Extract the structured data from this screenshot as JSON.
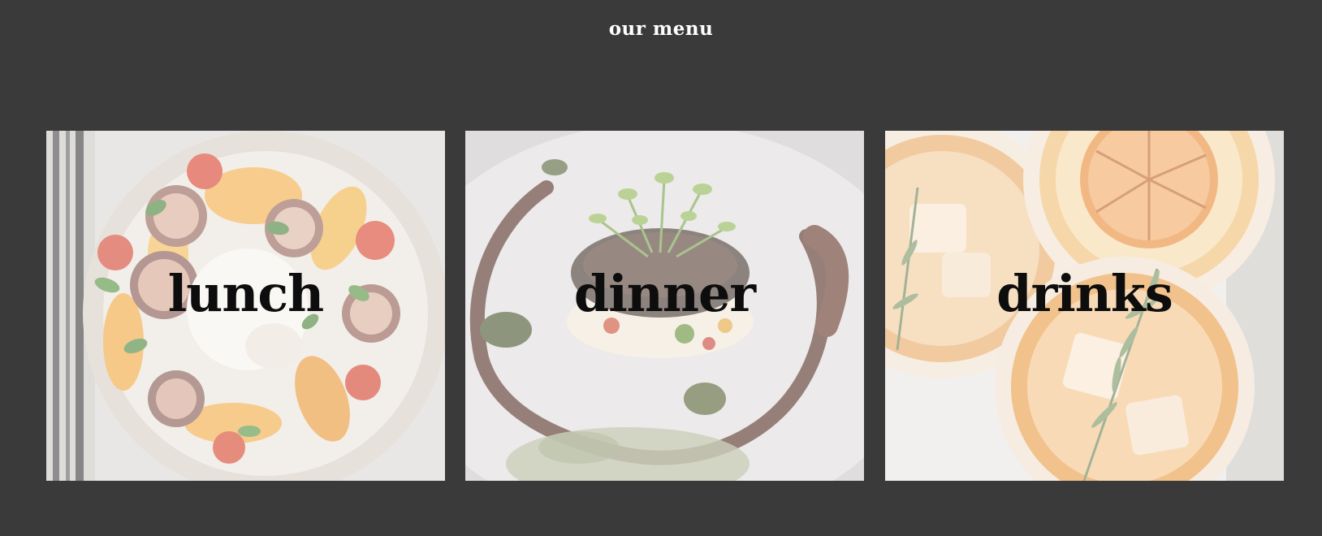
{
  "page": {
    "title": "our menu",
    "background": "#3a3a3a"
  },
  "menu": {
    "items": [
      {
        "label": "lunch"
      },
      {
        "label": "dinner"
      },
      {
        "label": "drinks"
      }
    ]
  }
}
